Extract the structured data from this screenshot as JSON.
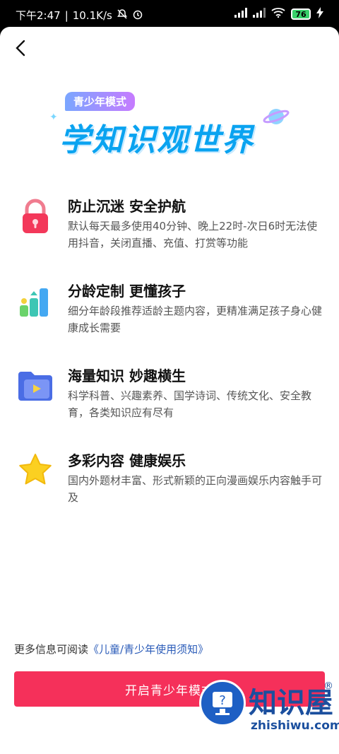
{
  "status_bar": {
    "time": "下午2:47",
    "speed": "10.1K/s",
    "battery": "76"
  },
  "hero": {
    "badge": "青少年模式",
    "title": "学知识观世界"
  },
  "features": [
    {
      "icon": "lock-icon",
      "title": "防止沉迷 安全护航",
      "desc": "默认每天最多使用40分钟、晚上22时-次日6时无法使用抖音，关闭直播、充值、打赏等功能"
    },
    {
      "icon": "bar-chart-icon",
      "title": "分龄定制 更懂孩子",
      "desc": "细分年龄段推荐适龄主题内容，更精准满足孩子身心健康成长需要"
    },
    {
      "icon": "video-folder-icon",
      "title": "海量知识 妙趣横生",
      "desc": "科学科普、兴趣素养、国学诗词、传统文化、安全教育，各类知识应有尽有"
    },
    {
      "icon": "star-icon",
      "title": "多彩内容 健康娱乐",
      "desc": "国内外题材丰富、形式新颖的正向漫画娱乐内容触手可及"
    }
  ],
  "footer": {
    "note_prefix": "更多信息可阅读",
    "note_link": "《儿童/青少年使用须知》",
    "button_label": "开启青少年模式"
  },
  "watermark": {
    "brand": "知识屋",
    "url": "zhishiwu.com",
    "reg": "®"
  },
  "colors": {
    "accent": "#f5305a",
    "title_blue": "#0aa3f0",
    "link": "#2a5bb8"
  }
}
